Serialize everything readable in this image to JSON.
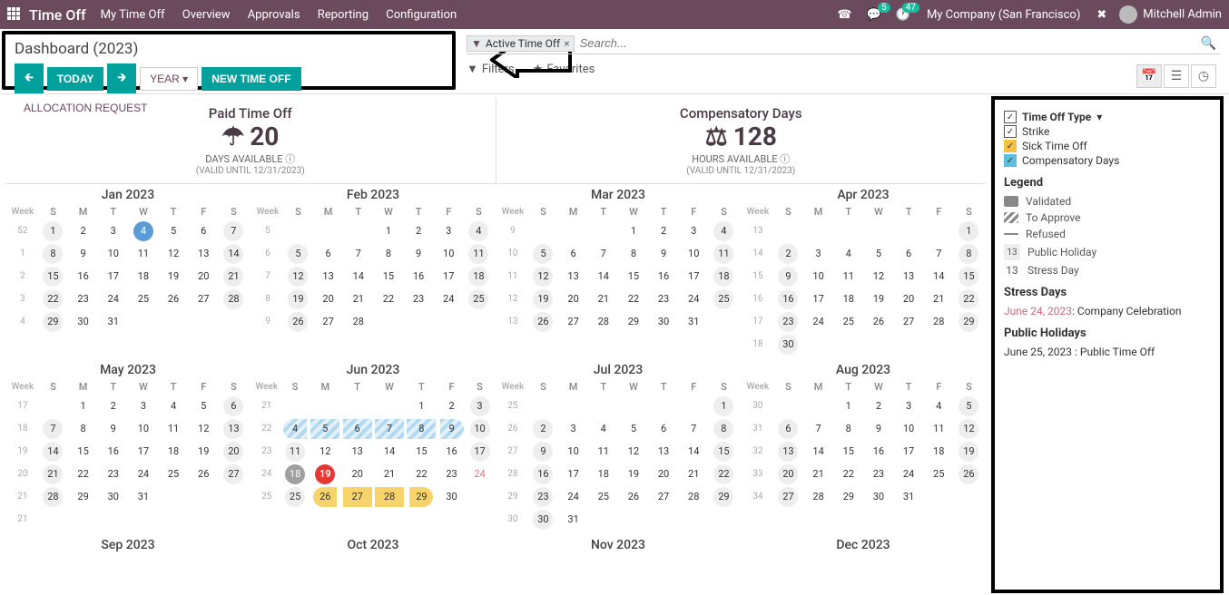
{
  "topbar": {
    "brand": "Time Off",
    "nav": [
      "My Time Off",
      "Overview",
      "Approvals",
      "Reporting",
      "Configuration"
    ],
    "msg_badge": "5",
    "clock_badge": "47",
    "company": "My Company (San Francisco)",
    "user": "Mitchell Admin"
  },
  "control": {
    "title": "Dashboard (2023)",
    "today": "TODAY",
    "year": "YEAR",
    "new_time_off": "NEW TIME OFF",
    "allocation_request": "ALLOCATION REQUEST"
  },
  "search": {
    "filter_tag": "Active Time Off",
    "placeholder": "Search...",
    "filters": "Filters",
    "favorites": "Favorites"
  },
  "summary": {
    "pto": {
      "title": "Paid Time Off",
      "value": "20",
      "sub": "DAYS AVAILABLE",
      "valid": "(VALID UNTIL 12/31/2023)"
    },
    "comp": {
      "title": "Compensatory Days",
      "value": "128",
      "sub": "HOURS AVAILABLE",
      "valid": "(VALID UNTIL 12/31/2023)"
    }
  },
  "legend": {
    "group_label": "Time Off Type",
    "types": [
      "Strike",
      "Sick Time Off",
      "Compensatory Days"
    ],
    "legend_title": "Legend",
    "validated": "Validated",
    "to_approve": "To Approve",
    "refused": "Refused",
    "public_holiday": "Public Holiday",
    "stress_day": "Stress Day",
    "ph_num": "13",
    "sd_num": "13",
    "stress_title": "Stress Days",
    "stress_item_date": "June 24, 2023",
    "stress_item_text": ": Company Celebration",
    "ph_title": "Public Holidays",
    "ph_item_date": "June 25, 2023",
    "ph_item_text": ": Public Time Off"
  },
  "dow": [
    "S",
    "M",
    "T",
    "W",
    "T",
    "F",
    "S"
  ],
  "week_label": "Week",
  "months": [
    {
      "name": "Jan 2023",
      "weeks": [
        52,
        1,
        2,
        3,
        4
      ],
      "start": 0,
      "days": 31,
      "specials": {
        "4": "sel",
        "1": "muted",
        "7": "muted",
        "8": "muted",
        "14": "muted",
        "15": "muted",
        "21": "muted",
        "22": "muted",
        "28": "muted",
        "29": "muted"
      }
    },
    {
      "name": "Feb 2023",
      "weeks": [
        5,
        6,
        7,
        8,
        9
      ],
      "start": 3,
      "days": 28,
      "specials": {
        "4": "muted",
        "5": "muted",
        "11": "muted",
        "12": "muted",
        "18": "muted",
        "19": "muted",
        "25": "muted",
        "26": "muted"
      }
    },
    {
      "name": "Mar 2023",
      "weeks": [
        9,
        10,
        11,
        12,
        13
      ],
      "start": 3,
      "days": 31,
      "specials": {
        "4": "muted",
        "5": "muted",
        "11": "muted",
        "12": "muted",
        "18": "muted",
        "19": "muted",
        "25": "muted",
        "26": "muted"
      }
    },
    {
      "name": "Apr 2023",
      "weeks": [
        13,
        14,
        15,
        16,
        17,
        18
      ],
      "start": 6,
      "days": 30,
      "specials": {
        "1": "muted",
        "2": "muted",
        "8": "muted",
        "9": "muted",
        "15": "muted",
        "16": "muted",
        "22": "muted",
        "23": "muted",
        "29": "muted",
        "30": "muted"
      }
    },
    {
      "name": "May 2023",
      "weeks": [
        17,
        18,
        19,
        20,
        21,
        21
      ],
      "start": 1,
      "days": 31,
      "specials": {
        "6": "muted",
        "7": "muted",
        "13": "muted",
        "14": "muted",
        "20": "muted",
        "21": "muted",
        "27": "muted",
        "28": "muted"
      }
    },
    {
      "name": "Jun 2023",
      "weeks": [
        21,
        22,
        23,
        24,
        25
      ],
      "start": 4,
      "days": 30,
      "specials": {
        "3": "muted",
        "4": "pending pendfirst",
        "5": "pending pendmid",
        "6": "pending pendmid",
        "7": "pending pendmid",
        "8": "pending pendmid",
        "9": "pending pendlast",
        "10": "muted",
        "11": "muted",
        "17": "muted",
        "18": "strike",
        "19": "today",
        "24": "str",
        "25": "muted",
        "26": "sick sickfirst",
        "27": "sick sickmid",
        "28": "sick sickmid",
        "29": "sick sicklast"
      }
    },
    {
      "name": "Jul 2023",
      "weeks": [
        25,
        26,
        27,
        28,
        29,
        30
      ],
      "start": 6,
      "days": 31,
      "specials": {
        "1": "muted",
        "2": "muted",
        "8": "muted",
        "9": "muted",
        "15": "muted",
        "16": "muted",
        "22": "muted",
        "23": "muted",
        "29": "muted",
        "30": "muted"
      }
    },
    {
      "name": "Aug 2023",
      "weeks": [
        30,
        31,
        32,
        33,
        34
      ],
      "start": 2,
      "days": 31,
      "specials": {
        "5": "muted",
        "6": "muted",
        "12": "muted",
        "13": "muted",
        "19": "muted",
        "20": "muted",
        "26": "muted",
        "27": "muted"
      }
    },
    {
      "name": "Sep 2023",
      "weeks": [],
      "start": 5,
      "days": 0,
      "header_only": true
    },
    {
      "name": "Oct 2023",
      "weeks": [],
      "start": 0,
      "days": 0,
      "header_only": true
    },
    {
      "name": "Nov 2023",
      "weeks": [],
      "start": 3,
      "days": 0,
      "header_only": true
    },
    {
      "name": "Dec 2023",
      "weeks": [],
      "start": 5,
      "days": 0,
      "header_only": true
    }
  ]
}
